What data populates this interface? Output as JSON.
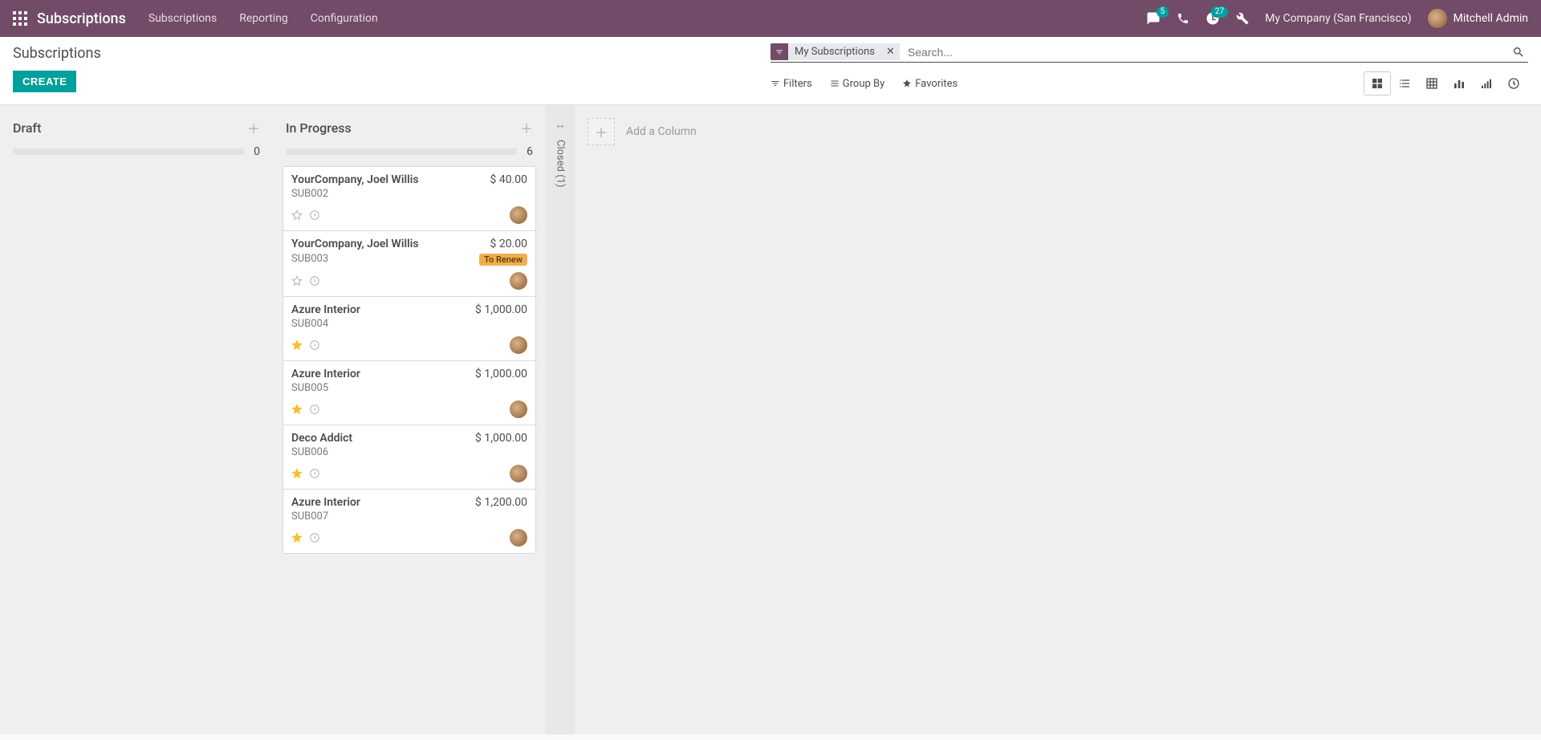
{
  "navbar": {
    "brand": "Subscriptions",
    "menu": [
      "Subscriptions",
      "Reporting",
      "Configuration"
    ],
    "chat_badge": "5",
    "activity_badge": "27",
    "company": "My Company (San Francisco)",
    "user": "Mitchell Admin"
  },
  "control": {
    "breadcrumb": "Subscriptions",
    "create_label": "CREATE",
    "search_placeholder": "Search...",
    "filter_facet": "My Subscriptions",
    "tools": {
      "filters": "Filters",
      "groupby": "Group By",
      "favorites": "Favorites"
    }
  },
  "kanban": {
    "add_column": "Add a Column",
    "folded": {
      "label": "Closed (1)"
    },
    "columns": [
      {
        "title": "Draft",
        "count": "0",
        "cards": []
      },
      {
        "title": "In Progress",
        "count": "6",
        "cards": [
          {
            "name": "YourCompany, Joel Willis",
            "price": "$ 40.00",
            "ref": "SUB002",
            "star": false,
            "to_renew": false
          },
          {
            "name": "YourCompany, Joel Willis",
            "price": "$ 20.00",
            "ref": "SUB003",
            "star": false,
            "to_renew": true
          },
          {
            "name": "Azure Interior",
            "price": "$ 1,000.00",
            "ref": "SUB004",
            "star": true,
            "to_renew": false
          },
          {
            "name": "Azure Interior",
            "price": "$ 1,000.00",
            "ref": "SUB005",
            "star": true,
            "to_renew": false
          },
          {
            "name": "Deco Addict",
            "price": "$ 1,000.00",
            "ref": "SUB006",
            "star": true,
            "to_renew": false
          },
          {
            "name": "Azure Interior",
            "price": "$ 1,200.00",
            "ref": "SUB007",
            "star": true,
            "to_renew": false
          }
        ]
      }
    ]
  },
  "labels": {
    "to_renew": "To Renew"
  }
}
